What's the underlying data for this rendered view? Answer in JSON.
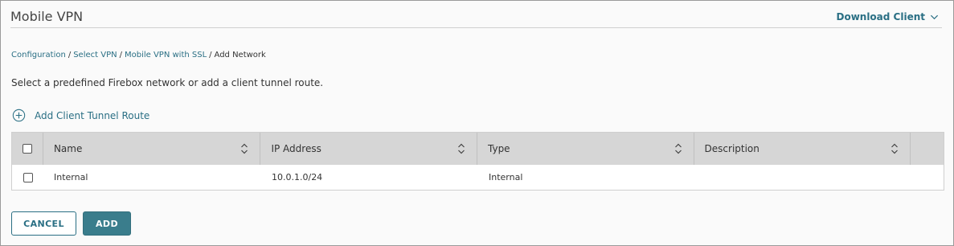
{
  "header": {
    "title": "Mobile VPN",
    "download_label": "Download Client",
    "download_icon": "chevron-down-icon"
  },
  "breadcrumb": {
    "items": [
      "Configuration",
      "Select VPN",
      "Mobile VPN with SSL"
    ],
    "current": "Add Network",
    "separator": "/"
  },
  "instructions": "Select a predefined Firebox network or add a client tunnel route.",
  "add_route": {
    "label": "Add Client Tunnel Route",
    "icon": "plus-circle-icon"
  },
  "table": {
    "columns": [
      "Name",
      "IP Address",
      "Type",
      "Description"
    ],
    "rows": [
      {
        "name": "Internal",
        "ip": "10.0.1.0/24",
        "type": "Internal",
        "description": ""
      }
    ]
  },
  "buttons": {
    "cancel": "CANCEL",
    "add": "ADD"
  },
  "colors": {
    "accent": "#2a6f84",
    "primary_button": "#3a7d8c",
    "header_row": "#d6d6d6"
  }
}
